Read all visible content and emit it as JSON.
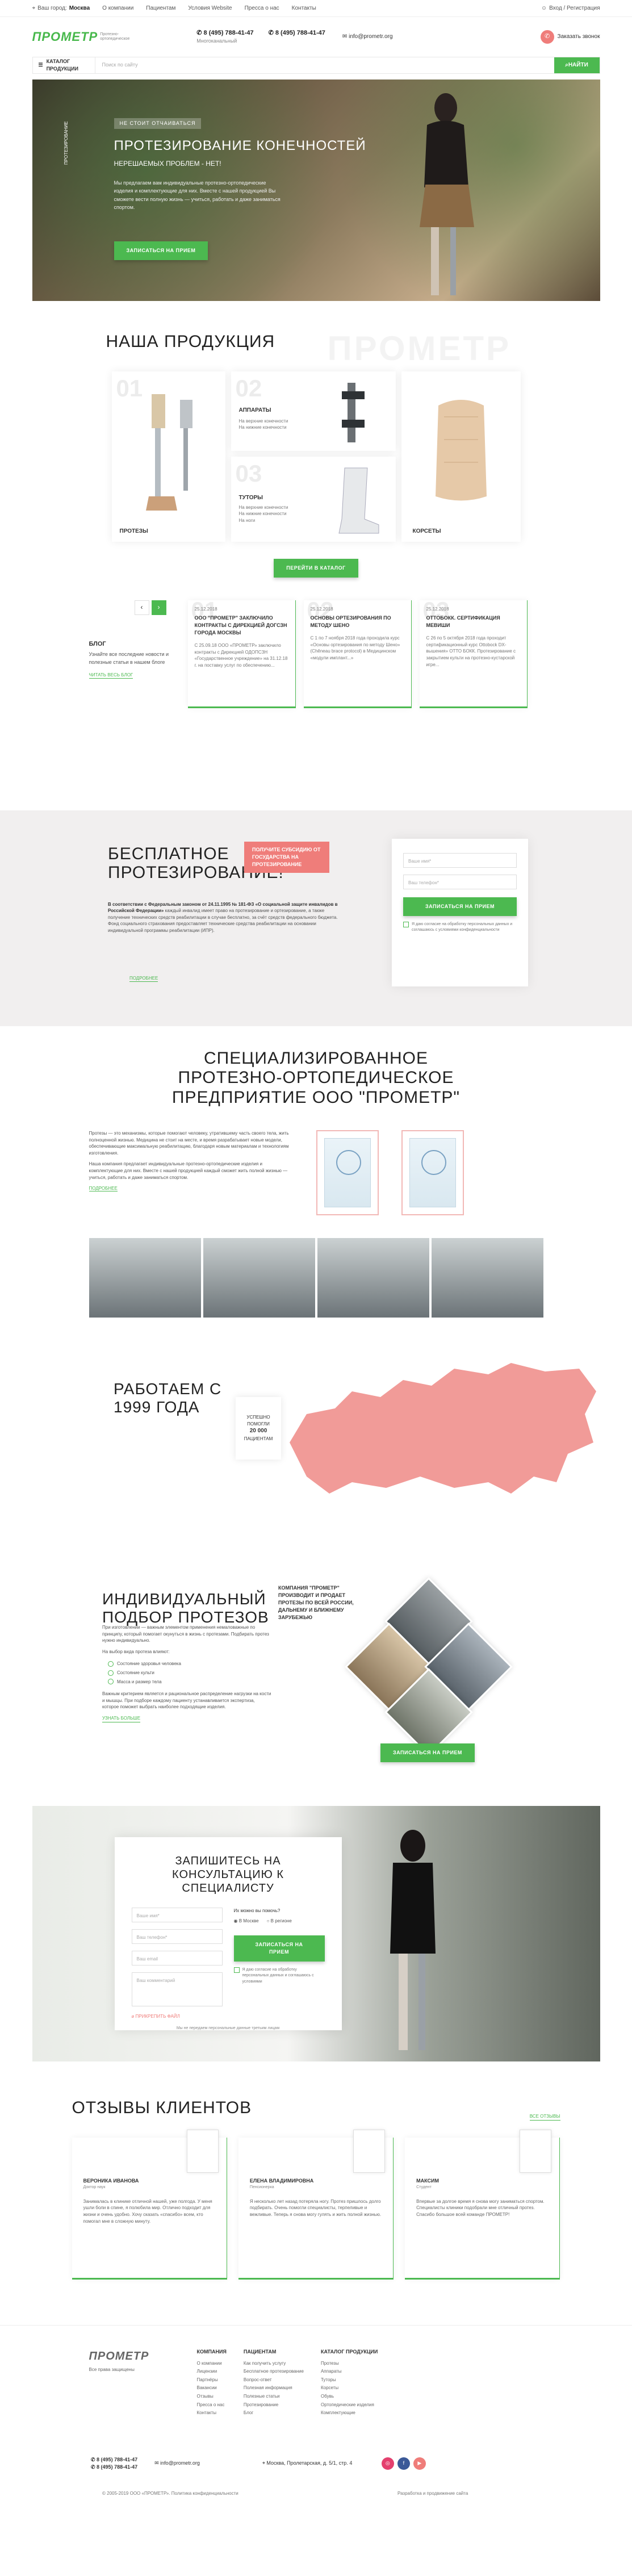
{
  "topbar": {
    "city_label": "Ваш город:",
    "city": "Москва",
    "links": [
      "О компании",
      "Пациентам",
      "Условия Website",
      "Пресса о нас",
      "Контакты"
    ],
    "cabinet": "Вход / Регистрация"
  },
  "header": {
    "logo": "ПРОМЕТР",
    "logo_tag": "Протезно-ортопедическое",
    "phone1": "8 (495) 788-41-47",
    "phone1_note": "Многоканальный",
    "phone2": "8 (495) 788-41-47",
    "email": "info@prometr.org",
    "call_label": "Заказать звонок"
  },
  "catalog": {
    "button": "КАТАЛОГ ПРОДУКЦИИ",
    "search_placeholder": "Поиск по сайту",
    "find": "НАЙТИ"
  },
  "hero": {
    "tag": "НЕ СТОИТ ОТЧАИВАТЬСЯ",
    "title": "ПРОТЕЗИРОВАНИЕ КОНЕЧНОСТЕЙ",
    "subtitle": "НЕРЕШАЕМЫХ ПРОБЛЕМ - НЕТ!",
    "desc": "Мы предлагаем вам индивидуальные протезно-ортопедические изделия и комплектующие для них. Вместе с нашей продукцией Вы сможете вести полную жизнь — учиться, работать и даже заниматься спортом.",
    "button": "ЗАПИСАТЬСЯ НА ПРИЕМ",
    "side": "ПРОТЕЗИРОВАНИЕ"
  },
  "products": {
    "title": "НАША ПРОДУКЦИЯ",
    "ghost": "ПРОМЕТР",
    "items": [
      {
        "num": "01",
        "label": "ПРОТЕЗЫ"
      },
      {
        "num": "02",
        "label": "АППАРАТЫ",
        "sub": [
          "На верхние конечности",
          "На нижние конечности"
        ]
      },
      {
        "num": "03",
        "label": "ТУТОРЫ",
        "sub": [
          "На верхние конечности",
          "На нижние конечности",
          "На ноги"
        ]
      },
      {
        "num": "",
        "label": "КОРСЕТЫ"
      }
    ],
    "button": "ПЕРЕЙТИ В КАТАЛОГ"
  },
  "blog": {
    "title": "БЛОГ",
    "desc": "Узнайте все последние новости и полезные статьи в нашем блоге",
    "more": "ЧИТАТЬ ВЕСЬ БЛОГ",
    "posts": [
      {
        "num": "01",
        "date": "25.12.2018",
        "title": "ООО \"ПРОМЕТР\" ЗАКЛЮЧИЛО КОНТРАКТЫ С ДИРЕКЦИЕЙ ДОГСЗН ГОРОДА МОСКВЫ",
        "text": "С 25.09.18 ООО «ПРОМЕТР» заключило контракты с Дирекцией ОДОПСЗН «Государственное учреждение» на 31.12.18 г. на поставку услуг по обеспечению..."
      },
      {
        "num": "02",
        "date": "25.12.2018",
        "title": "ОСНОВЫ ОРТЕЗИРОВАНИЯ ПО МЕТОДУ ШЕНО",
        "text": "С 1 по 7 ноября 2018 года проходила курс «Основы ортезирования по методу Шено» (Chêneau brace protocol) в Медицинском «модули имплант...»"
      },
      {
        "num": "03",
        "date": "25.12.2018",
        "title": "ОТТОБОКК. СЕРТИФИКАЦИЯ МЕВИШИ",
        "text": "С 26 по 5 октября 2018 года проходит сертификационный курс Ottobock DX-вышения» ОТТО БОКК. Протезирование с закрытием культи на протезно-кустарской игре..."
      }
    ]
  },
  "free": {
    "title": "БЕСПЛАТНОЕ ПРОТЕЗИРОВАНИЕ!",
    "badge": "ПОЛУЧИТЕ СУБСИДИЮ ОТ ГОСУДАРСТВА НА ПРОТЕЗИРОВАНИЕ",
    "lead": "В соответствии с Федеральным законом от 24.11.1995 № 181-ФЗ «О социальной защите инвалидов в Российской Федерации»",
    "text": "каждый инвалид имеет право на протезирование и ортезирование, а также получение технических средств реабилитации в случае бесплатно, за счёт средств федерального бюджета. Фонд социального страхования предоставляет технические средства реабилитации на основании индивидуальной программы реабилитации (ИПР).",
    "more": "ПОДРОБНЕЕ",
    "form": {
      "name": "Ваше имя*",
      "phone": "Ваш телефон*",
      "button": "ЗАПИСАТЬСЯ НА ПРИЕМ",
      "consent": "Я даю согласие на обработку персональных данных и соглашаюсь с условиями конфиденциальности"
    }
  },
  "about": {
    "title": "СПЕЦИАЛИЗИРОВАННОЕ ПРОТЕЗНО-ОРТОПЕДИЧЕСКОЕ ПРЕДПРИЯТИЕ ООО \"ПРОМЕТР\"",
    "p1": "Протезы — это механизмы, которые помогают человеку, утратившему часть своего тела, жить полноценной жизнью. Медицина не стоит на месте, и время разрабатывает новые модели, обеспечивающие максимальную реабилитацию, благодаря новым материалам и технологиям изготовления.",
    "p2": "Наша компания предлагает индивидуальные протезно-ортопедические изделия и комплектующие для них. Вместе с нашей продукцией каждый сможет жить полной жизнью — учиться, работать и даже заниматься спортом.",
    "more": "ПОДРОБНЕЕ"
  },
  "map": {
    "title": "РАБОТАЕМ С 1999 ГОДА",
    "badge_l1": "УСПЕШНО ПОМОГЛИ",
    "badge_num": "20 000",
    "badge_l2": "ПАЦИЕНТАМ"
  },
  "indiv": {
    "title": "ИНДИВИДУАЛЬНЫЙ ПОДБОР ПРОТЕЗОВ",
    "right": "КОМПАНИЯ \"ПРОМЕТР\" ПРОИЗВОДИТ И ПРОДАЕТ ПРОТЕЗЫ ПО ВСЕЙ РОССИИ, ДАЛЬНЕМУ И БЛИЖНЕМУ ЗАРУБЕЖЬЮ",
    "text": "При изготовлении — важным элементом применения немаловажные по принципу, который помогает окунуться в жизнь с протезами. Подбирать протез нужно индивидуально.",
    "list_title": "На выбор вида протеза влияют:",
    "list": [
      "Состояние здоровья человека",
      "Состояние культи",
      "Масса и размер тела"
    ],
    "text2": "Важным критерием является и рациональное распределение нагрузки на кости и мышцы. При подборе каждому пациенту устанавливается экспертиза, которое поможет выбрать наиболее подходящие изделия.",
    "more": "УЗНАТЬ БОЛЬШЕ",
    "button": "ЗАПИСАТЬСЯ НА ПРИЕМ"
  },
  "consult": {
    "title": "ЗАПИШИТЕСЬ НА КОНСУЛЬТАЦИЮ К СПЕЦИАЛИСТУ",
    "name": "Ваше имя*",
    "phone": "Ваш телефон*",
    "email": "Ваш email",
    "file": "ПРИКРЕПИТЬ ФАЙЛ",
    "comment": "Ваш комментарий",
    "need": "Их можно вы помочь?",
    "opt1": "В Москве",
    "opt2": "В регионе",
    "button": "ЗАПИСАТЬСЯ НА ПРИЕМ",
    "consent": "Я даю согласие на обработку персональных данных и соглашаюсь с условиями",
    "note": "Мы не передаем персональные данные третьим лицам"
  },
  "reviews": {
    "title": "ОТЗЫВЫ КЛИЕНТОВ",
    "all": "ВСЕ ОТЗЫВЫ",
    "items": [
      {
        "name": "ВЕРОНИКА ИВАНОВА",
        "role": "Доктор наук",
        "text": "Занималась в клинике отличной нашей, уже полгода. У меня ушли боли в спине, я полюбила мир. Отлично подходит для жизни и очень удобно. Хочу сказать «спасибо» всем, кто помогал мне в сложную минуту."
      },
      {
        "name": "ЕЛЕНА ВЛАДИМИРОВНА",
        "role": "Пенсионерка",
        "text": "Я несколько лет назад потеряла ногу. Протез пришлось долго подбирать. Очень помогли специалисты, терпеливые и вежливые. Теперь я снова могу гулять и жить полной жизнью."
      },
      {
        "name": "МАКСИМ",
        "role": "Студент",
        "text": "Впервые за долгое время я снова могу заниматься спортом. Специалисты клиники подобрали мне отличный протез. Спасибо большое всей команде ПРОМЕТР!"
      }
    ]
  },
  "footer": {
    "logo": "ПРОМЕТР",
    "logo_sub": "Все права защищены",
    "cols": [
      {
        "title": "КОМПАНИЯ",
        "items": [
          "О компании",
          "Лицензии",
          "Партнёры",
          "Вакансии",
          "Отзывы",
          "Пресса о нас",
          "Контакты"
        ]
      },
      {
        "title": "ПАЦИЕНТАМ",
        "items": [
          "Как получить услугу",
          "Бесплатное протезирование",
          "Вопрос-ответ",
          "Полезная информация",
          "Полезные статьи",
          "Протезирование",
          "Блог"
        ]
      },
      {
        "title": "КАТАЛОГ ПРОДУКЦИИ",
        "items": [
          "Протезы",
          "Аппараты",
          "Туторы",
          "Корсеты",
          "Обувь",
          "Ортопедические изделия",
          "Комплектующие"
        ]
      }
    ],
    "phone1": "8 (495) 788-41-47",
    "phone2": "8 (495) 788-41-47",
    "email": "info@prometr.org",
    "address": "Москва, Пролетарская, д. 5/1, стр. 4",
    "copy": "© 2005-2019 ООО «ПРОМЕТР». Политика конфиденциальности",
    "dev": "Разработка и продвижение сайта"
  },
  "colors": {
    "green": "#4cb950",
    "pink": "#ef7d7a"
  }
}
